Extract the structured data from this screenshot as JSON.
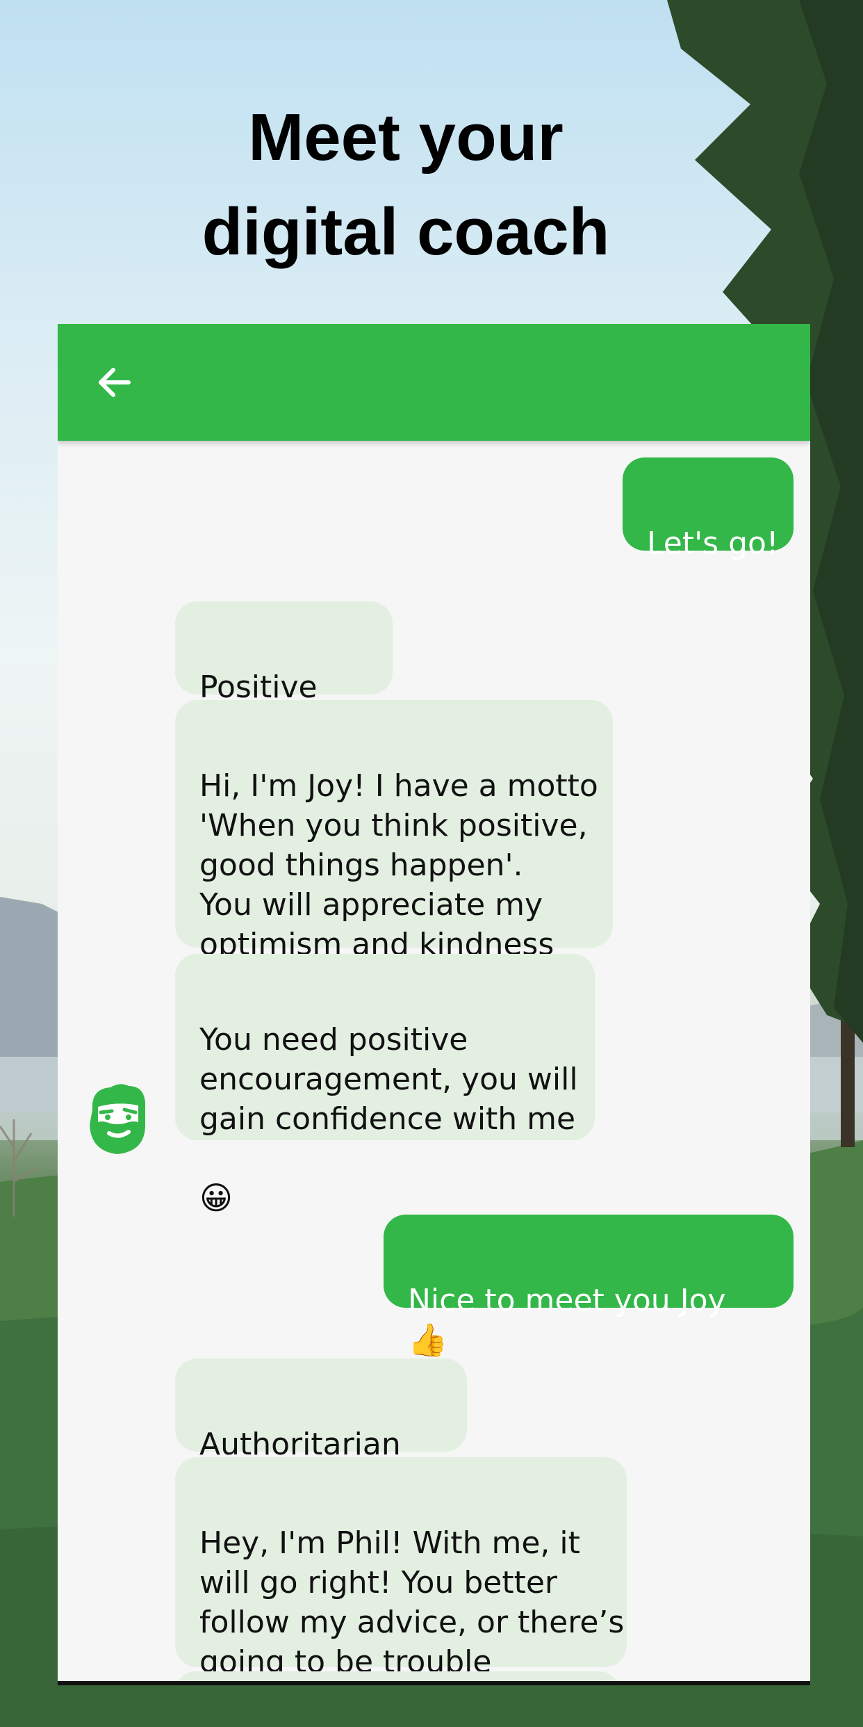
{
  "headline": {
    "line1": "Meet your",
    "line2": "digital coach"
  },
  "colors": {
    "accent": "#33b748",
    "bot_bubble": "#e2efe1",
    "chat_bg": "#f6f6f6"
  },
  "app_bar": {
    "back_icon": "arrow-left-icon"
  },
  "messages": [
    {
      "from": "user",
      "text": "Let's go!"
    },
    {
      "from": "coach",
      "text": "Positive",
      "emoji": "👇"
    },
    {
      "from": "coach",
      "text": "Hi, I'm Joy! I have a motto\n'When you think positive,\ngood things happen'.\nYou will appreciate my\noptimism and kindness"
    },
    {
      "from": "coach",
      "text": "You need positive\nencouragement, you will\ngain confidence with me",
      "emoji": "😀"
    },
    {
      "from": "user",
      "text": "Nice to meet you Joy",
      "emoji": "👍"
    },
    {
      "from": "coach",
      "text": "Authoritarian",
      "emoji": "👇"
    },
    {
      "from": "coach",
      "text": "Hey, I'm Phil! With me, it\nwill go right! You better\nfollow my advice, or there’s\ngoing to be trouble"
    }
  ],
  "avatar_icon": "bearded-man-avatar-icon"
}
